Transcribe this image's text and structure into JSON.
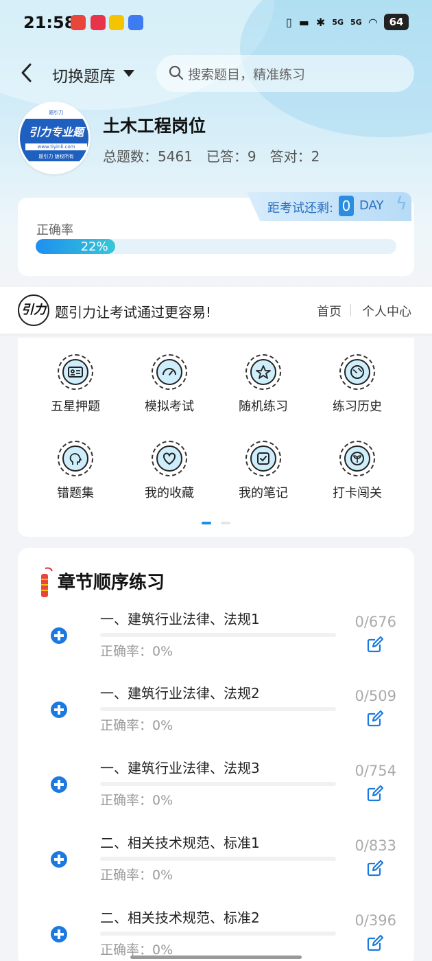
{
  "status_bar": {
    "time": "21:58",
    "battery": "64",
    "network_1": "5G",
    "network_2": "5G"
  },
  "header": {
    "switch_label": "切换题库",
    "search_placeholder": "搜索题目，精准练习"
  },
  "profile": {
    "logo_text": "引力专业题",
    "logo_url": "www.tiyinli.com",
    "logo_footer": "题引力 版权所有",
    "title": "土木工程岗位",
    "total_label": "总题数：5461",
    "answered_label": "已答：9",
    "correct_label": "答对：2"
  },
  "accuracy": {
    "label": "正确率",
    "value_text": "22%",
    "value": 0.22
  },
  "exam_countdown": {
    "label": "距考试还剩:",
    "days": "0",
    "unit": "DAY"
  },
  "slogan": {
    "logo_text": "题引力",
    "text": "题引力让考试通过更容易!",
    "nav_home": "首页",
    "nav_user": "个人中心"
  },
  "grid": {
    "items": [
      {
        "label": "五星押题",
        "icon": "id-card-icon"
      },
      {
        "label": "模拟考试",
        "icon": "speedometer-icon"
      },
      {
        "label": "随机练习",
        "icon": "star-network-icon"
      },
      {
        "label": "练习历史",
        "icon": "globe-clock-icon"
      },
      {
        "label": "错题集",
        "icon": "head-brain-icon"
      },
      {
        "label": "我的收藏",
        "icon": "heart-icon"
      },
      {
        "label": "我的笔记",
        "icon": "note-check-icon"
      },
      {
        "label": "打卡闯关",
        "icon": "leaf-icon"
      }
    ],
    "page_count": 2,
    "active_page": 1
  },
  "chapters": {
    "title": "章节顺序练习",
    "items": [
      {
        "name": "一、建筑行业法律、法规1",
        "accuracy": "正确率：0%",
        "count": "0/676",
        "progress": 0
      },
      {
        "name": "一、建筑行业法律、法规2",
        "accuracy": "正确率：0%",
        "count": "0/509",
        "progress": 0
      },
      {
        "name": "一、建筑行业法律、法规3",
        "accuracy": "正确率：0%",
        "count": "0/754",
        "progress": 0
      },
      {
        "name": "二、相关技术规范、标准1",
        "accuracy": "正确率：0%",
        "count": "0/833",
        "progress": 0
      },
      {
        "name": "二、相关技术规范、标准2",
        "accuracy": "正确率：0%",
        "count": "0/396",
        "progress": 0
      }
    ]
  },
  "colors": {
    "accent": "#1b79e0",
    "progress_start": "#1d8ff0",
    "progress_end": "#38c6d6",
    "icon_fill": "#cfeefb"
  }
}
